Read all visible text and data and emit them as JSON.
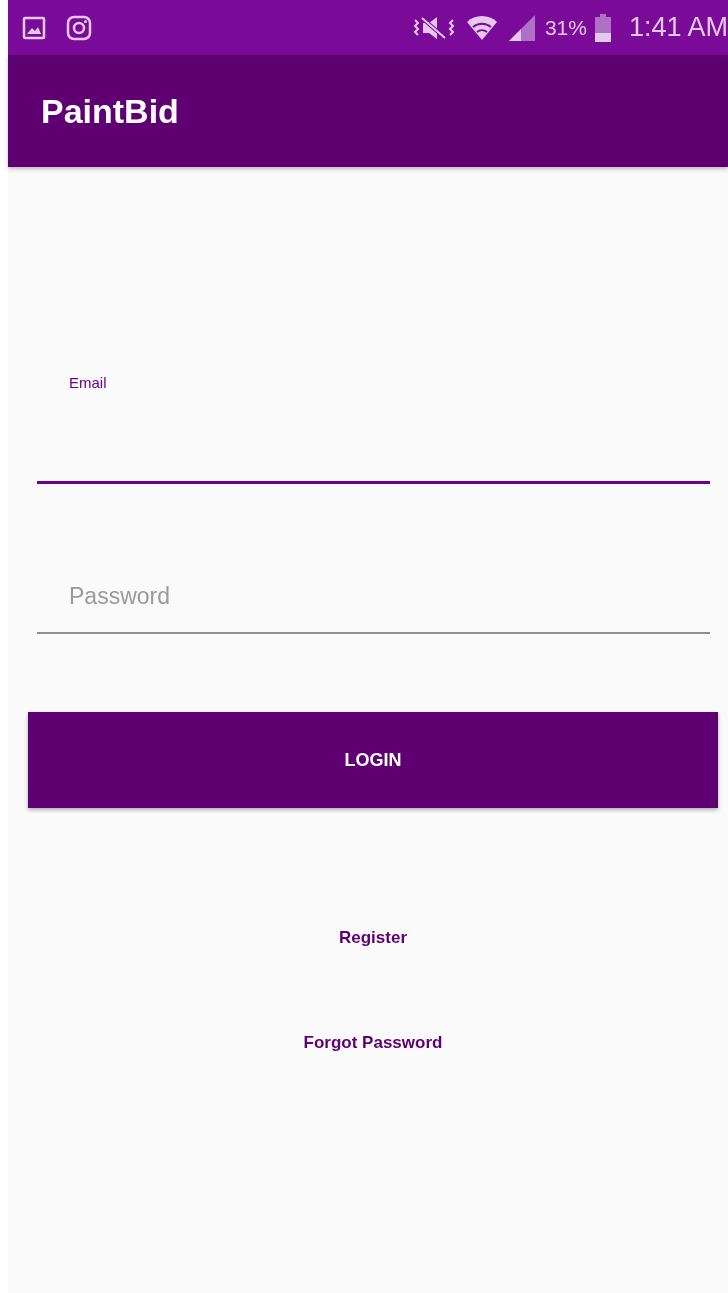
{
  "status_bar": {
    "battery_text": "31%",
    "time": "1:41 AM"
  },
  "app_bar": {
    "title": "PaintBid"
  },
  "fields": [
    {
      "label": "Email",
      "focused": true
    },
    {
      "label": "Password",
      "focused": false
    }
  ],
  "login_button": {
    "label": "LOGIN"
  },
  "links": [
    "Register",
    "Forgot Password"
  ]
}
